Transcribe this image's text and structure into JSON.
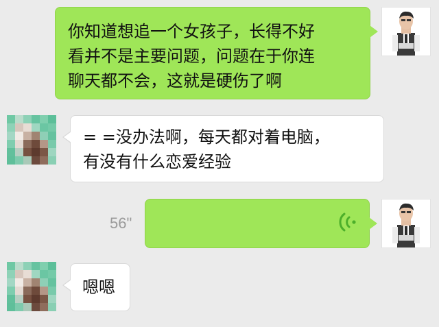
{
  "messages": [
    {
      "sender": "me",
      "type": "text",
      "text": "你知道想追一个女孩子，长得不好\n看并不是主要问题，问题在于你连\n聊天都不会，这就是硬伤了啊"
    },
    {
      "sender": "them",
      "type": "text",
      "text": "= =没办法啊，每天都对着电脑，\n有没有什么恋爱经验"
    },
    {
      "sender": "me",
      "type": "voice",
      "duration": "56\""
    },
    {
      "sender": "them",
      "type": "text",
      "text": "嗯嗯"
    }
  ],
  "colors": {
    "background": "#ebebeb",
    "my_bubble": "#9fe658",
    "their_bubble": "#ffffff",
    "voice_icon": "#4caf2a",
    "duration_text": "#9a9a9a"
  },
  "icons": {
    "voice": "voice-wave-icon"
  }
}
